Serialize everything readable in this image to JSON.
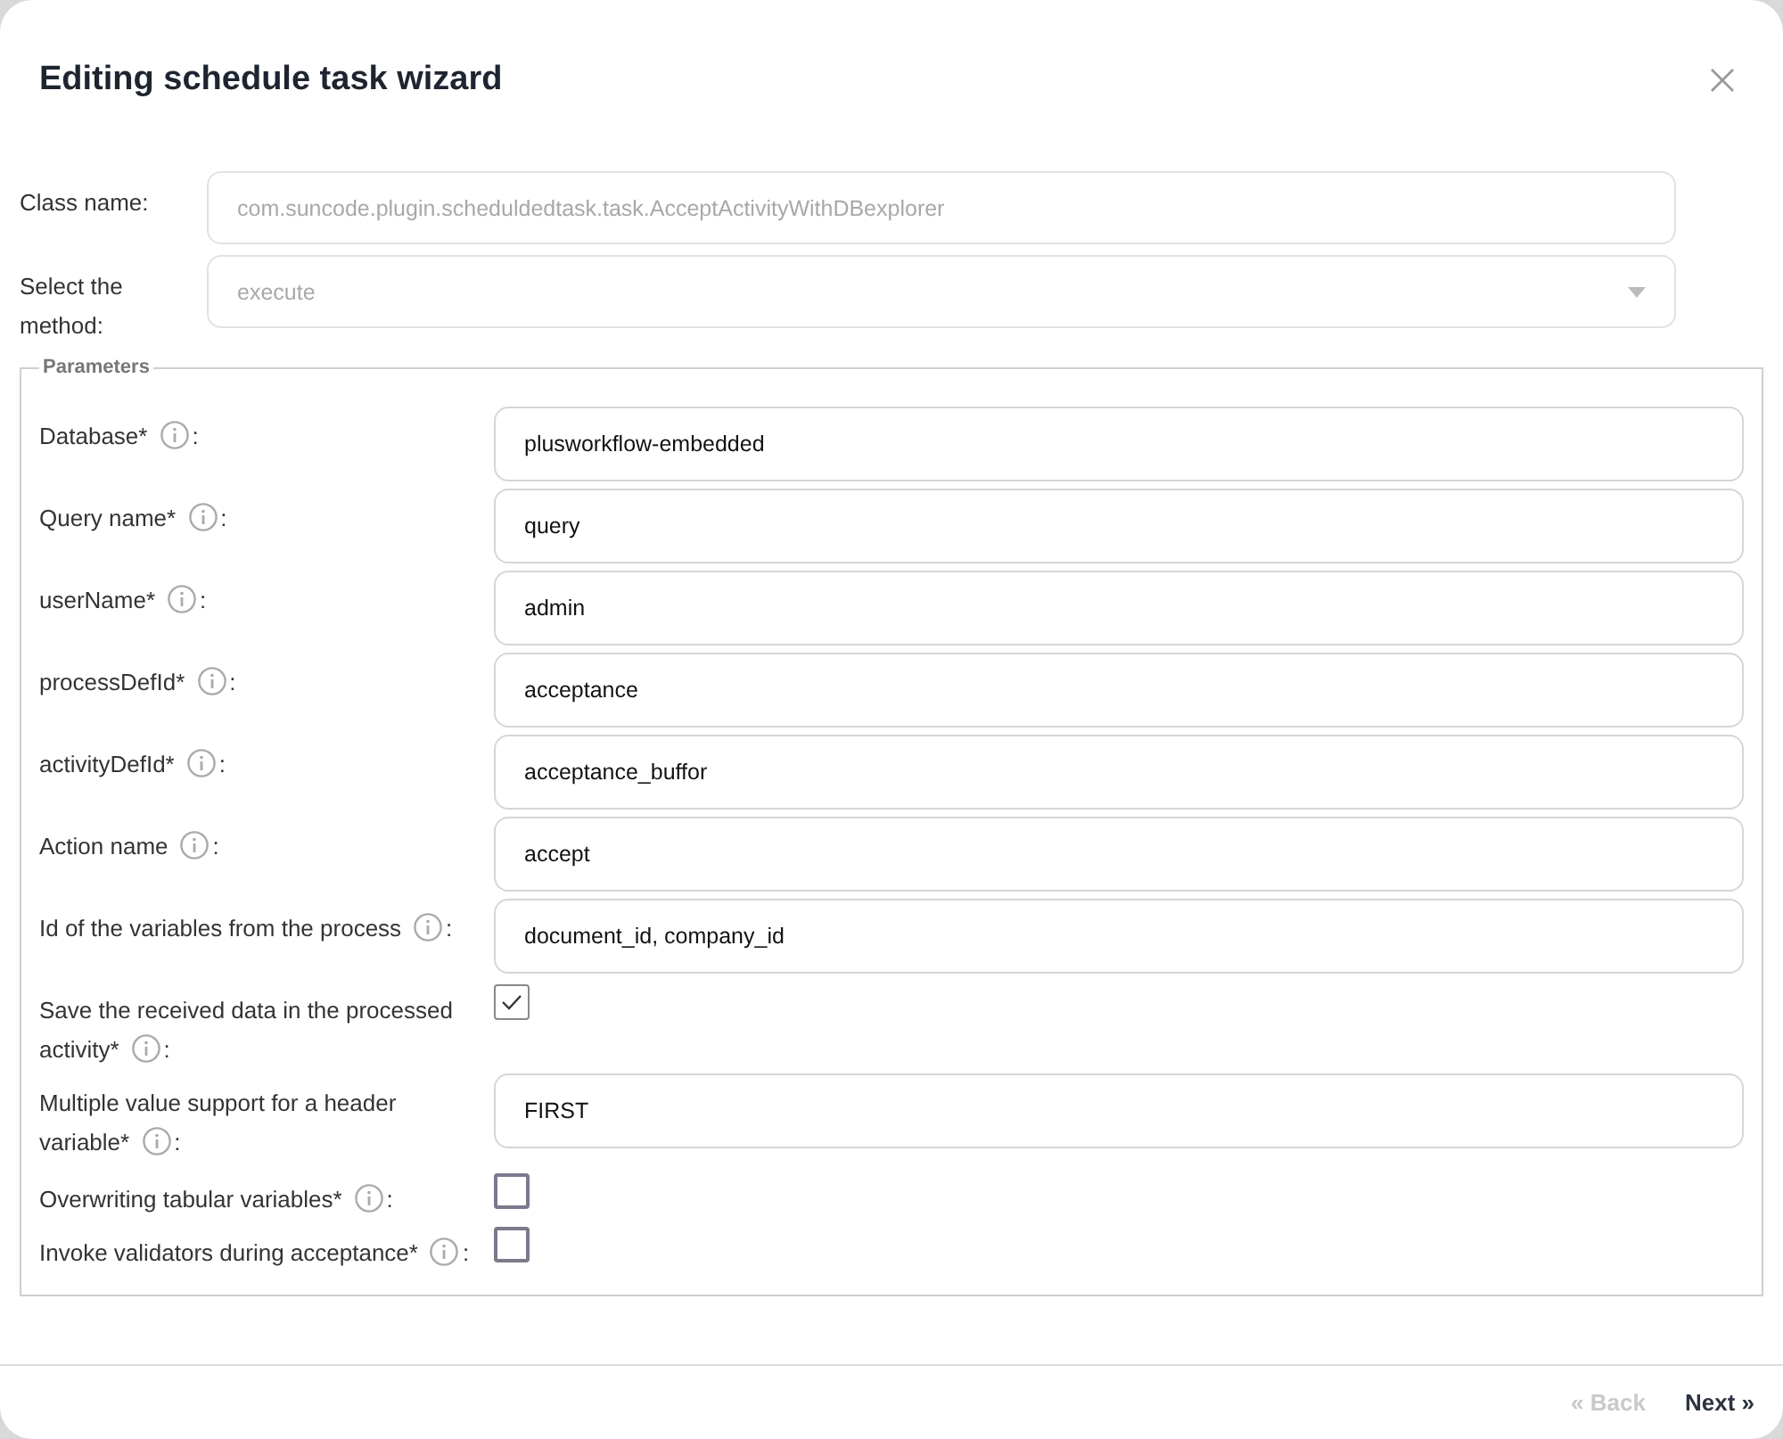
{
  "dialog": {
    "title": "Editing schedule task wizard"
  },
  "top_fields": [
    {
      "label": "Class name:",
      "value": "com.suncode.plugin.scheduldedtask.task.AcceptActivityWithDBexplorer",
      "kind": "text",
      "disabled": true
    },
    {
      "label": "Select the method:",
      "value": "execute",
      "kind": "select",
      "disabled": true
    }
  ],
  "parameters": {
    "legend": "Parameters",
    "rows": [
      {
        "label": "Database*",
        "separator": ":",
        "kind": "text",
        "value": "plusworkflow-embedded"
      },
      {
        "label": "Query name*",
        "separator": ":",
        "kind": "text",
        "value": "query"
      },
      {
        "label": "userName*",
        "separator": ":",
        "kind": "text",
        "value": "admin"
      },
      {
        "label": "processDefId*",
        "separator": ":",
        "kind": "text",
        "value": "acceptance"
      },
      {
        "label": "activityDefId*",
        "separator": ":",
        "kind": "text",
        "value": "acceptance_buffor"
      },
      {
        "label": "Action name",
        "separator": ":",
        "kind": "text",
        "value": "accept"
      },
      {
        "label": "Id of the variables from the process",
        "separator": ":",
        "kind": "text",
        "value": "document_id, company_id"
      },
      {
        "label": "Save the received data in the processed activity*",
        "separator": ":",
        "kind": "checkbox",
        "checked": true
      },
      {
        "label": "Multiple value support for a header variable*",
        "separator": ":",
        "kind": "text",
        "value": "FIRST"
      },
      {
        "label": "Overwriting tabular variables*",
        "separator": ":",
        "kind": "checkbox",
        "checked": false
      },
      {
        "label": "Invoke validators during acceptance*",
        "separator": ":",
        "kind": "checkbox",
        "checked": false
      }
    ]
  },
  "footer": {
    "buttons": [
      {
        "label": "« Back",
        "disabled": true
      },
      {
        "label": "Next »",
        "disabled": false
      }
    ]
  }
}
